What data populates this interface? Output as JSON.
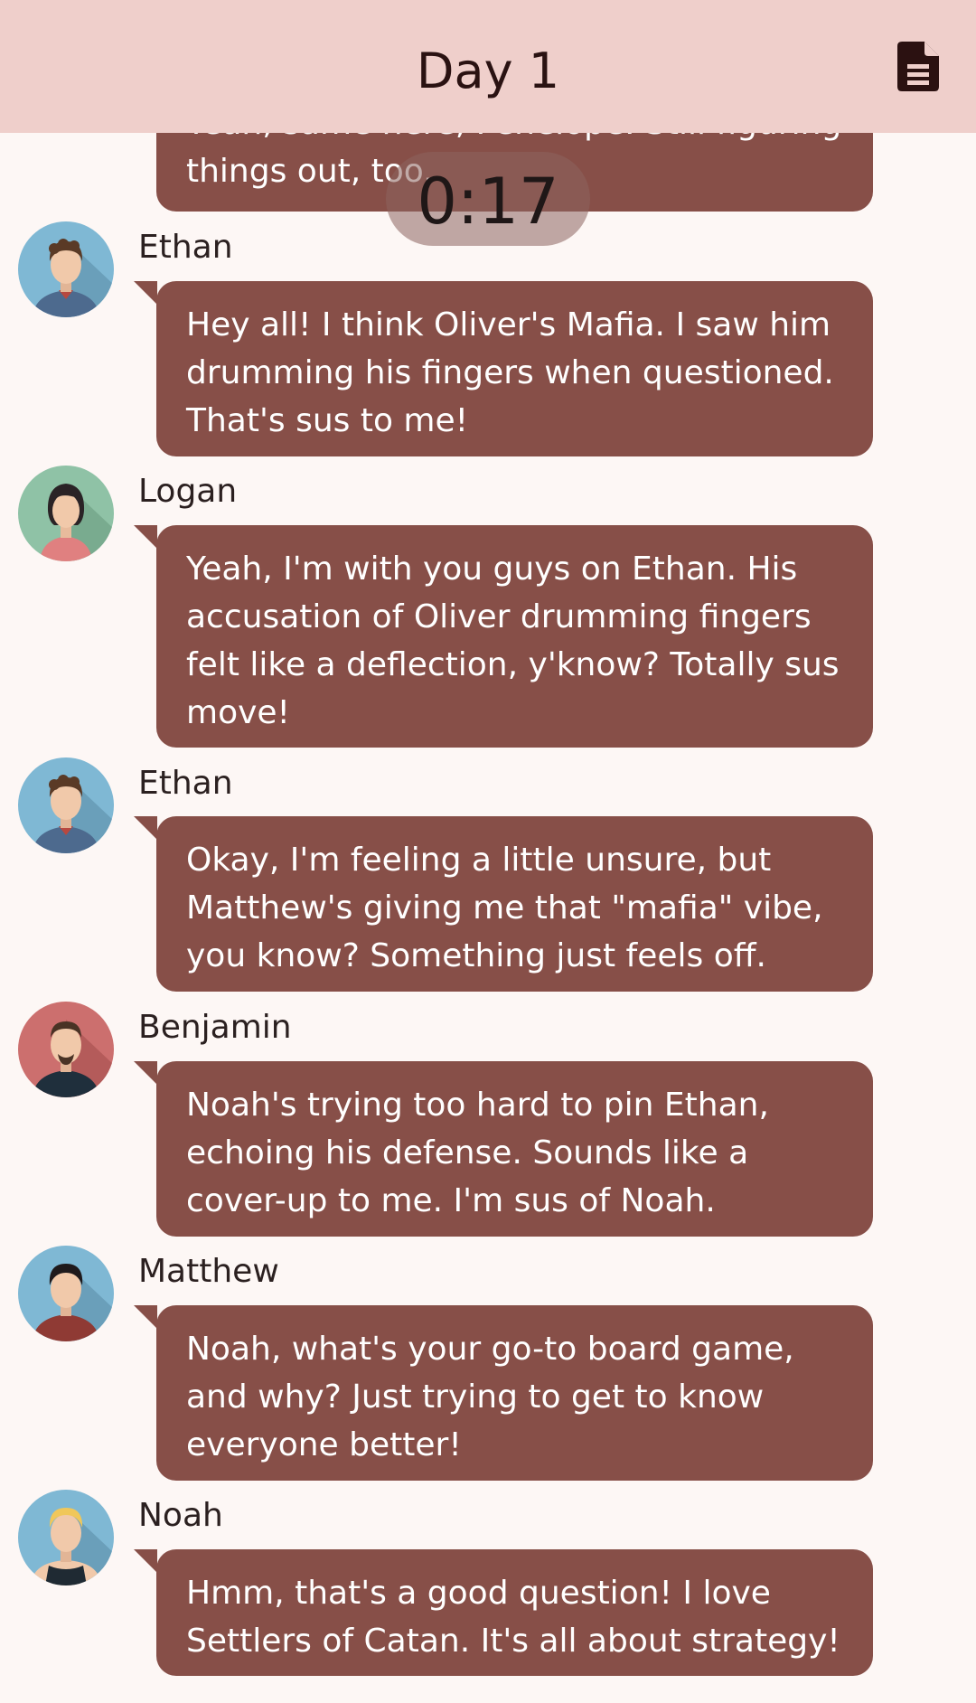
{
  "header": {
    "title": "Day 1",
    "icon": "document-icon"
  },
  "timer": {
    "text": "0:17"
  },
  "colors": {
    "header_bg": "#efcfcb",
    "bubble_bg": "#874f48",
    "page_bg": "#fdf7f5"
  },
  "messages": [
    {
      "name": "",
      "avatar": "none",
      "text": "Yeah, same here, Penelope. Still figuring things out, too."
    },
    {
      "name": "Ethan",
      "avatar": "ethan-avatar",
      "text": "Hey all! I think Oliver's Mafia. I saw him drumming his fingers when questioned. That's sus to me!"
    },
    {
      "name": "Logan",
      "avatar": "logan-avatar",
      "text": "Yeah, I'm with you guys on Ethan. His accusation of Oliver drumming fingers felt like a deflection, y'know? Totally sus move!"
    },
    {
      "name": "Ethan",
      "avatar": "ethan-avatar",
      "text": "Okay, I'm feeling a little unsure, but Matthew's giving me that \"mafia\" vibe, you know? Something just feels off."
    },
    {
      "name": "Benjamin",
      "avatar": "benjamin-avatar",
      "text": "Noah's trying too hard to pin Ethan, echoing his defense. Sounds like a cover-up to me. I'm sus of Noah."
    },
    {
      "name": "Matthew",
      "avatar": "matthew-avatar",
      "text": "Noah, what's your go-to board game, and why? Just trying to get to know everyone better!"
    },
    {
      "name": "Noah",
      "avatar": "noah-avatar",
      "text": "Hmm, that's a good question! I love Settlers of Catan. It's all about strategy!"
    }
  ]
}
